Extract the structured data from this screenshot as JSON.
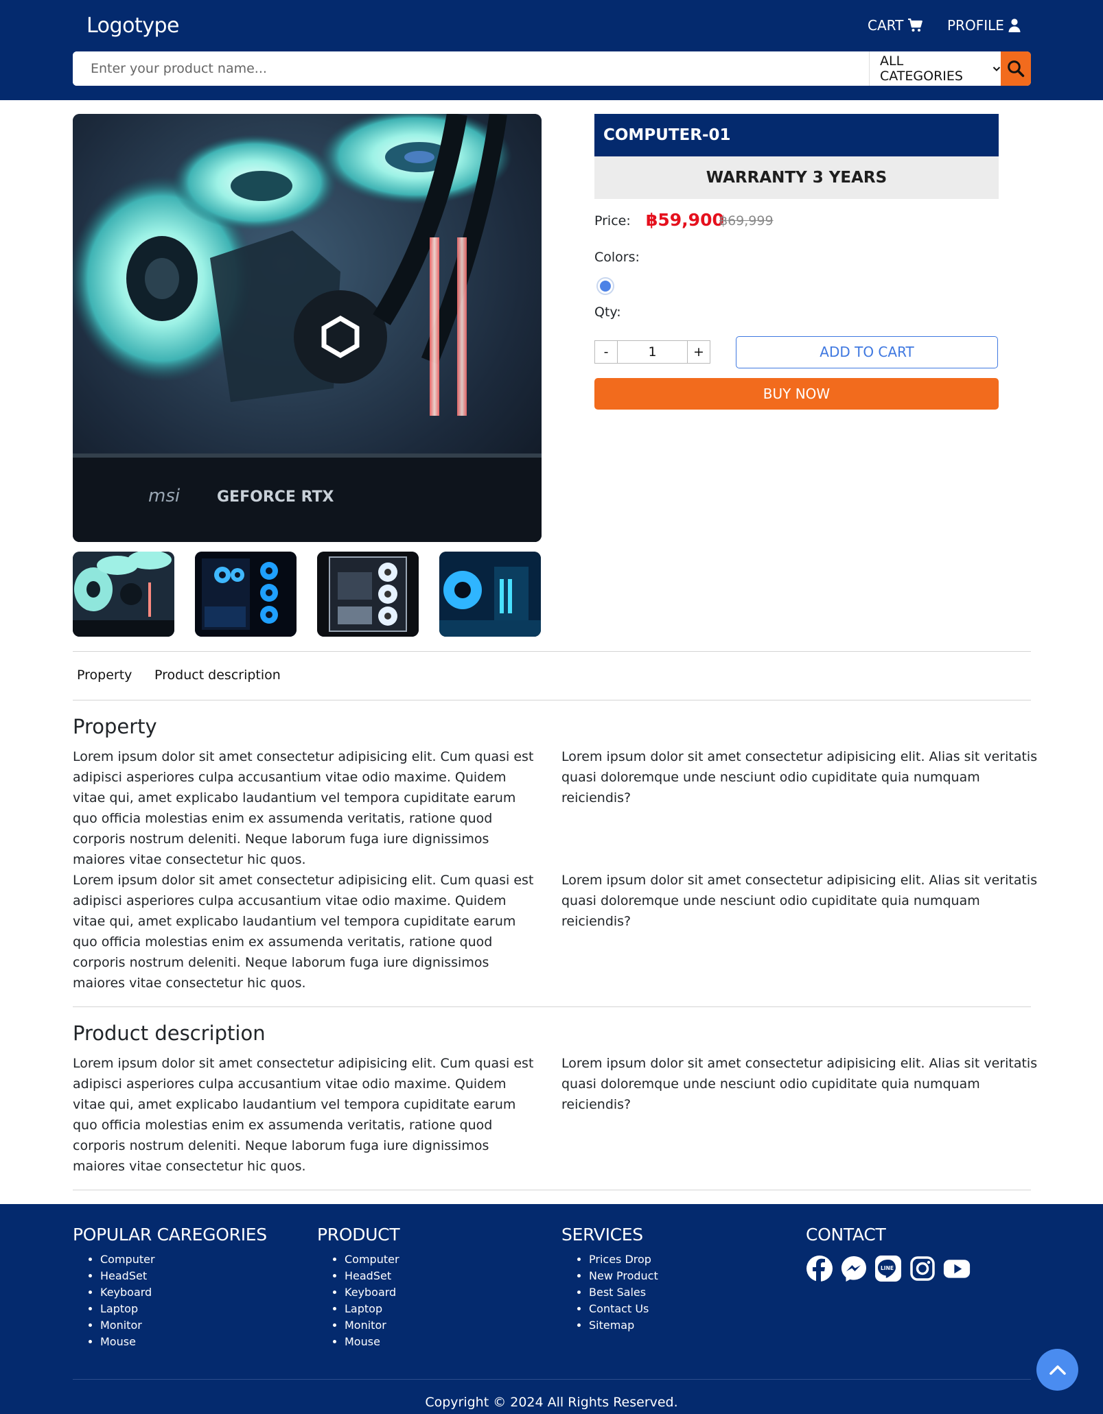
{
  "header": {
    "logo": "Logotype",
    "cart_label": "CART",
    "profile_label": "PROFILE",
    "search_placeholder": "Enter your product name...",
    "category_label": "ALL CATEGORIES",
    "brand_color": "#042a6e",
    "accent_color": "#f26b1d"
  },
  "gallery": {
    "main_image": "pc-interior-cyan-fans",
    "thumbnails": [
      "pc-interior-cyan-fans",
      "pc-case-blue-fans",
      "pc-case-white-fans",
      "pc-interior-blue-rgb"
    ]
  },
  "product": {
    "name": "COMPUTER-01",
    "warranty": "WARRANTY 3 YEARS",
    "price_label": "Price:",
    "price": "฿59,900",
    "old_price": "฿69,999",
    "colors_label": "Colors:",
    "colors": [
      "#4d82e6"
    ],
    "qty_label": "Qty:",
    "qty_minus": "-",
    "qty_plus": "+",
    "qty_value": "1",
    "add_to_cart": "ADD TO CART",
    "buy_now": "BUY NOW"
  },
  "tabs": [
    "Property",
    "Product description"
  ],
  "property": {
    "title": "Property",
    "left_1": "Lorem ipsum dolor sit amet consectetur adipisicing elit. Cum quasi est adipisci asperiores culpa accusantium vitae odio maxime. Quidem vitae qui, amet explicabo laudantium vel tempora cupiditate earum quo officia molestias enim ex assumenda veritatis, ratione quod corporis nostrum deleniti. Neque laborum fuga iure dignissimos maiores vitae consectetur hic quos.",
    "right_1": "Lorem ipsum dolor sit amet consectetur adipisicing elit. Alias sit veritatis quasi doloremque unde nesciunt odio cupiditate quia numquam reiciendis?",
    "left_2": "Lorem ipsum dolor sit amet consectetur adipisicing elit. Cum quasi est adipisci asperiores culpa accusantium vitae odio maxime. Quidem vitae qui, amet explicabo laudantium vel tempora cupiditate earum quo officia molestias enim ex assumenda veritatis, ratione quod corporis nostrum deleniti. Neque laborum fuga iure dignissimos maiores vitae consectetur hic quos.",
    "right_2": "Lorem ipsum dolor sit amet consectetur adipisicing elit. Alias sit veritatis quasi doloremque unde nesciunt odio cupiditate quia numquam reiciendis?"
  },
  "description": {
    "title": "Product description",
    "left": "Lorem ipsum dolor sit amet consectetur adipisicing elit. Cum quasi est adipisci asperiores culpa accusantium vitae odio maxime. Quidem vitae qui, amet explicabo laudantium vel tempora cupiditate earum quo officia molestias enim ex assumenda veritatis, ratione quod corporis nostrum deleniti. Neque laborum fuga iure dignissimos maiores vitae consectetur hic quos.",
    "right": "Lorem ipsum dolor sit amet consectetur adipisicing elit. Alias sit veritatis quasi doloremque unde nesciunt odio cupiditate quia numquam reiciendis?"
  },
  "footer": {
    "popular": {
      "title": "POPULAR CAREGORIES",
      "items": [
        "Computer",
        "HeadSet",
        "Keyboard",
        "Laptop",
        "Monitor",
        "Mouse"
      ]
    },
    "product": {
      "title": "PRODUCT",
      "items": [
        "Computer",
        "HeadSet",
        "Keyboard",
        "Laptop",
        "Monitor",
        "Mouse"
      ]
    },
    "services": {
      "title": "SERVICES",
      "items": [
        "Prices Drop",
        "New Product",
        "Best Sales",
        "Contact Us",
        "Sitemap"
      ]
    },
    "contact": {
      "title": "CONTACT",
      "socials": [
        "facebook-icon",
        "messenger-icon",
        "line-icon",
        "instagram-icon",
        "youtube-icon"
      ],
      "line_text": "LINE"
    },
    "copyright": "Copyright © 2024 All Rights Reserved."
  }
}
